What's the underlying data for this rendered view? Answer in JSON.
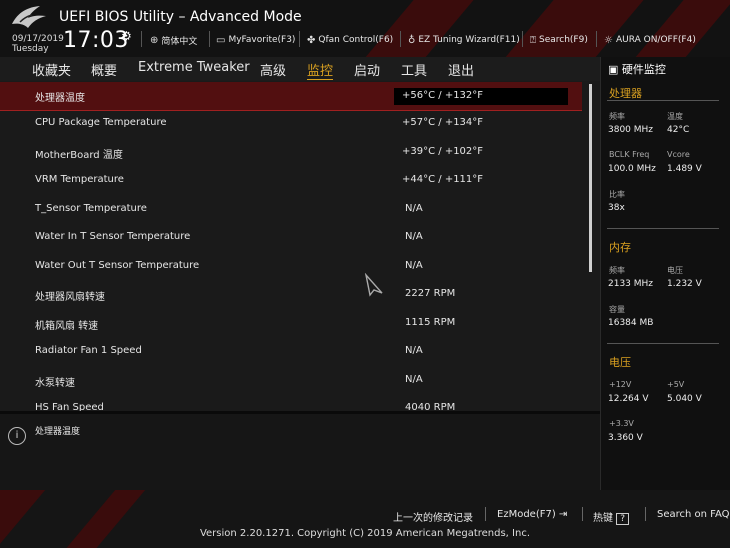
{
  "header": {
    "title": "UEFI BIOS Utility – Advanced Mode",
    "date": "09/17/2019",
    "weekday": "Tuesday",
    "time": "17:03",
    "toolbar": [
      {
        "icon": "globe-icon",
        "label": "简体中文"
      },
      {
        "icon": "favorite-icon",
        "label": "MyFavorite(F3)"
      },
      {
        "icon": "fan-icon",
        "label": "Qfan Control(F6)"
      },
      {
        "icon": "bulb-icon",
        "label": "EZ Tuning Wizard(F11)"
      },
      {
        "icon": "search-icon",
        "label": "Search(F9)"
      },
      {
        "icon": "aura-icon",
        "label": "AURA ON/OFF(F4)"
      }
    ]
  },
  "menu": {
    "items": [
      "收藏夹",
      "概要",
      "Extreme Tweaker",
      "高级",
      "监控",
      "启动",
      "工具",
      "退出"
    ],
    "active": "监控"
  },
  "rows": [
    {
      "label": "处理器温度",
      "value": "+56°C / +132°F"
    },
    {
      "label": "CPU Package Temperature",
      "value": "+57°C / +134°F"
    },
    {
      "label": "MotherBoard 温度",
      "value": "+39°C / +102°F"
    },
    {
      "label": "VRM Temperature",
      "value": "+44°C / +111°F"
    },
    {
      "label": "T_Sensor Temperature",
      "value": "N/A"
    },
    {
      "label": "Water In T Sensor Temperature",
      "value": "N/A"
    },
    {
      "label": "Water Out T Sensor Temperature",
      "value": "N/A"
    },
    {
      "label": "处理器风扇转速",
      "value": "2227 RPM"
    },
    {
      "label": "机箱风扇 转速",
      "value": "1115 RPM"
    },
    {
      "label": "Radiator Fan 1 Speed",
      "value": "N/A"
    },
    {
      "label": "水泵转速",
      "value": "N/A"
    },
    {
      "label": "HS Fan Speed",
      "value": "4040 RPM"
    }
  ],
  "help": {
    "text": "处理器温度"
  },
  "hwmon": {
    "title": "硬件监控",
    "cpu": {
      "title": "处理器",
      "freq_label": "频率",
      "freq": "3800 MHz",
      "temp_label": "温度",
      "temp": "42°C",
      "bclk_label": "BCLK Freq",
      "bclk": "100.0 MHz",
      "vcore_label": "Vcore",
      "vcore": "1.489 V",
      "ratio_label": "比率",
      "ratio": "38x"
    },
    "memory": {
      "title": "内存",
      "freq_label": "频率",
      "freq": "2133 MHz",
      "volt_label": "电压",
      "volt": "1.232 V",
      "cap_label": "容量",
      "cap": "16384 MB"
    },
    "voltage": {
      "title": "电压",
      "v12_label": "+12V",
      "v12": "12.264 V",
      "v5_label": "+5V",
      "v5": "5.040 V",
      "v33_label": "+3.3V",
      "v33": "3.360 V"
    }
  },
  "footer": {
    "last_modified": "上一次的修改记录",
    "ezmode": "EzMode(F7)",
    "hotkeys": "热键",
    "hotkeys_key": "?",
    "search_faq": "Search on FAQ",
    "version": "Version 2.20.1271. Copyright (C) 2019 American Megatrends, Inc."
  },
  "colors": {
    "accent": "#d9a020",
    "selected_row": "#520f10",
    "brand_red": "#a02020"
  }
}
